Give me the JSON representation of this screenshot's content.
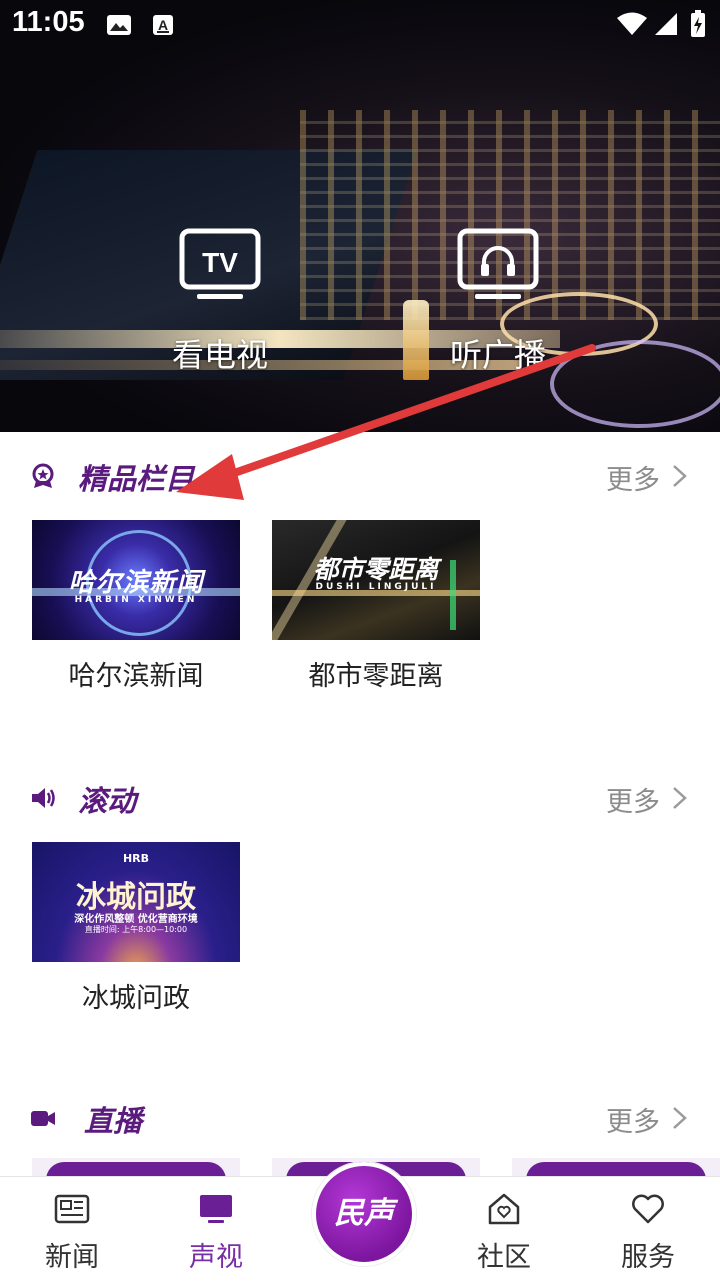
{
  "status_bar": {
    "time": "11:05",
    "icons": [
      "image-icon",
      "font-a-icon",
      "wifi-icon",
      "signal-icon",
      "battery-charging-icon"
    ]
  },
  "hero": {
    "buttons": [
      {
        "label": "看电视",
        "icon": "tv-icon",
        "icon_text": "TV"
      },
      {
        "label": "听广播",
        "icon": "radio-headphones-icon"
      }
    ]
  },
  "sections": [
    {
      "title": "精品栏目",
      "icon": "medal-icon",
      "more": "更多",
      "items": [
        {
          "caption": "哈尔滨新闻",
          "thumb_title": "哈尔滨新闻",
          "thumb_sub": "HARBIN XINWEN"
        },
        {
          "caption": "都市零距离",
          "thumb_title": "都市零距离",
          "thumb_sub": "DUSHI LINGJULI"
        }
      ]
    },
    {
      "title": "滚动",
      "icon": "speaker-icon",
      "more": "更多",
      "items": [
        {
          "caption": "冰城问政",
          "thumb_logo": "HRB",
          "thumb_title": "冰城问政",
          "thumb_sub": "深化作风整顿 优化营商环境",
          "thumb_time": "直播时间: 上午8:00—10:00"
        }
      ]
    },
    {
      "title": "直播",
      "icon": "video-camera-icon",
      "more": "更多"
    }
  ],
  "tabbar": {
    "tabs": [
      {
        "label": "新闻",
        "icon": "newspaper-icon",
        "active": false
      },
      {
        "label": "声视",
        "icon": "monitor-icon",
        "active": true
      },
      {
        "label": "社区",
        "icon": "home-heart-icon",
        "active": false
      },
      {
        "label": "服务",
        "icon": "heart-icon",
        "active": false
      }
    ],
    "center_button": "民声"
  },
  "colors": {
    "accent": "#7a2ea6",
    "title_purple": "#5a1a7e",
    "annotation_arrow": "#e03a3a",
    "muted": "#8c8c8c"
  }
}
